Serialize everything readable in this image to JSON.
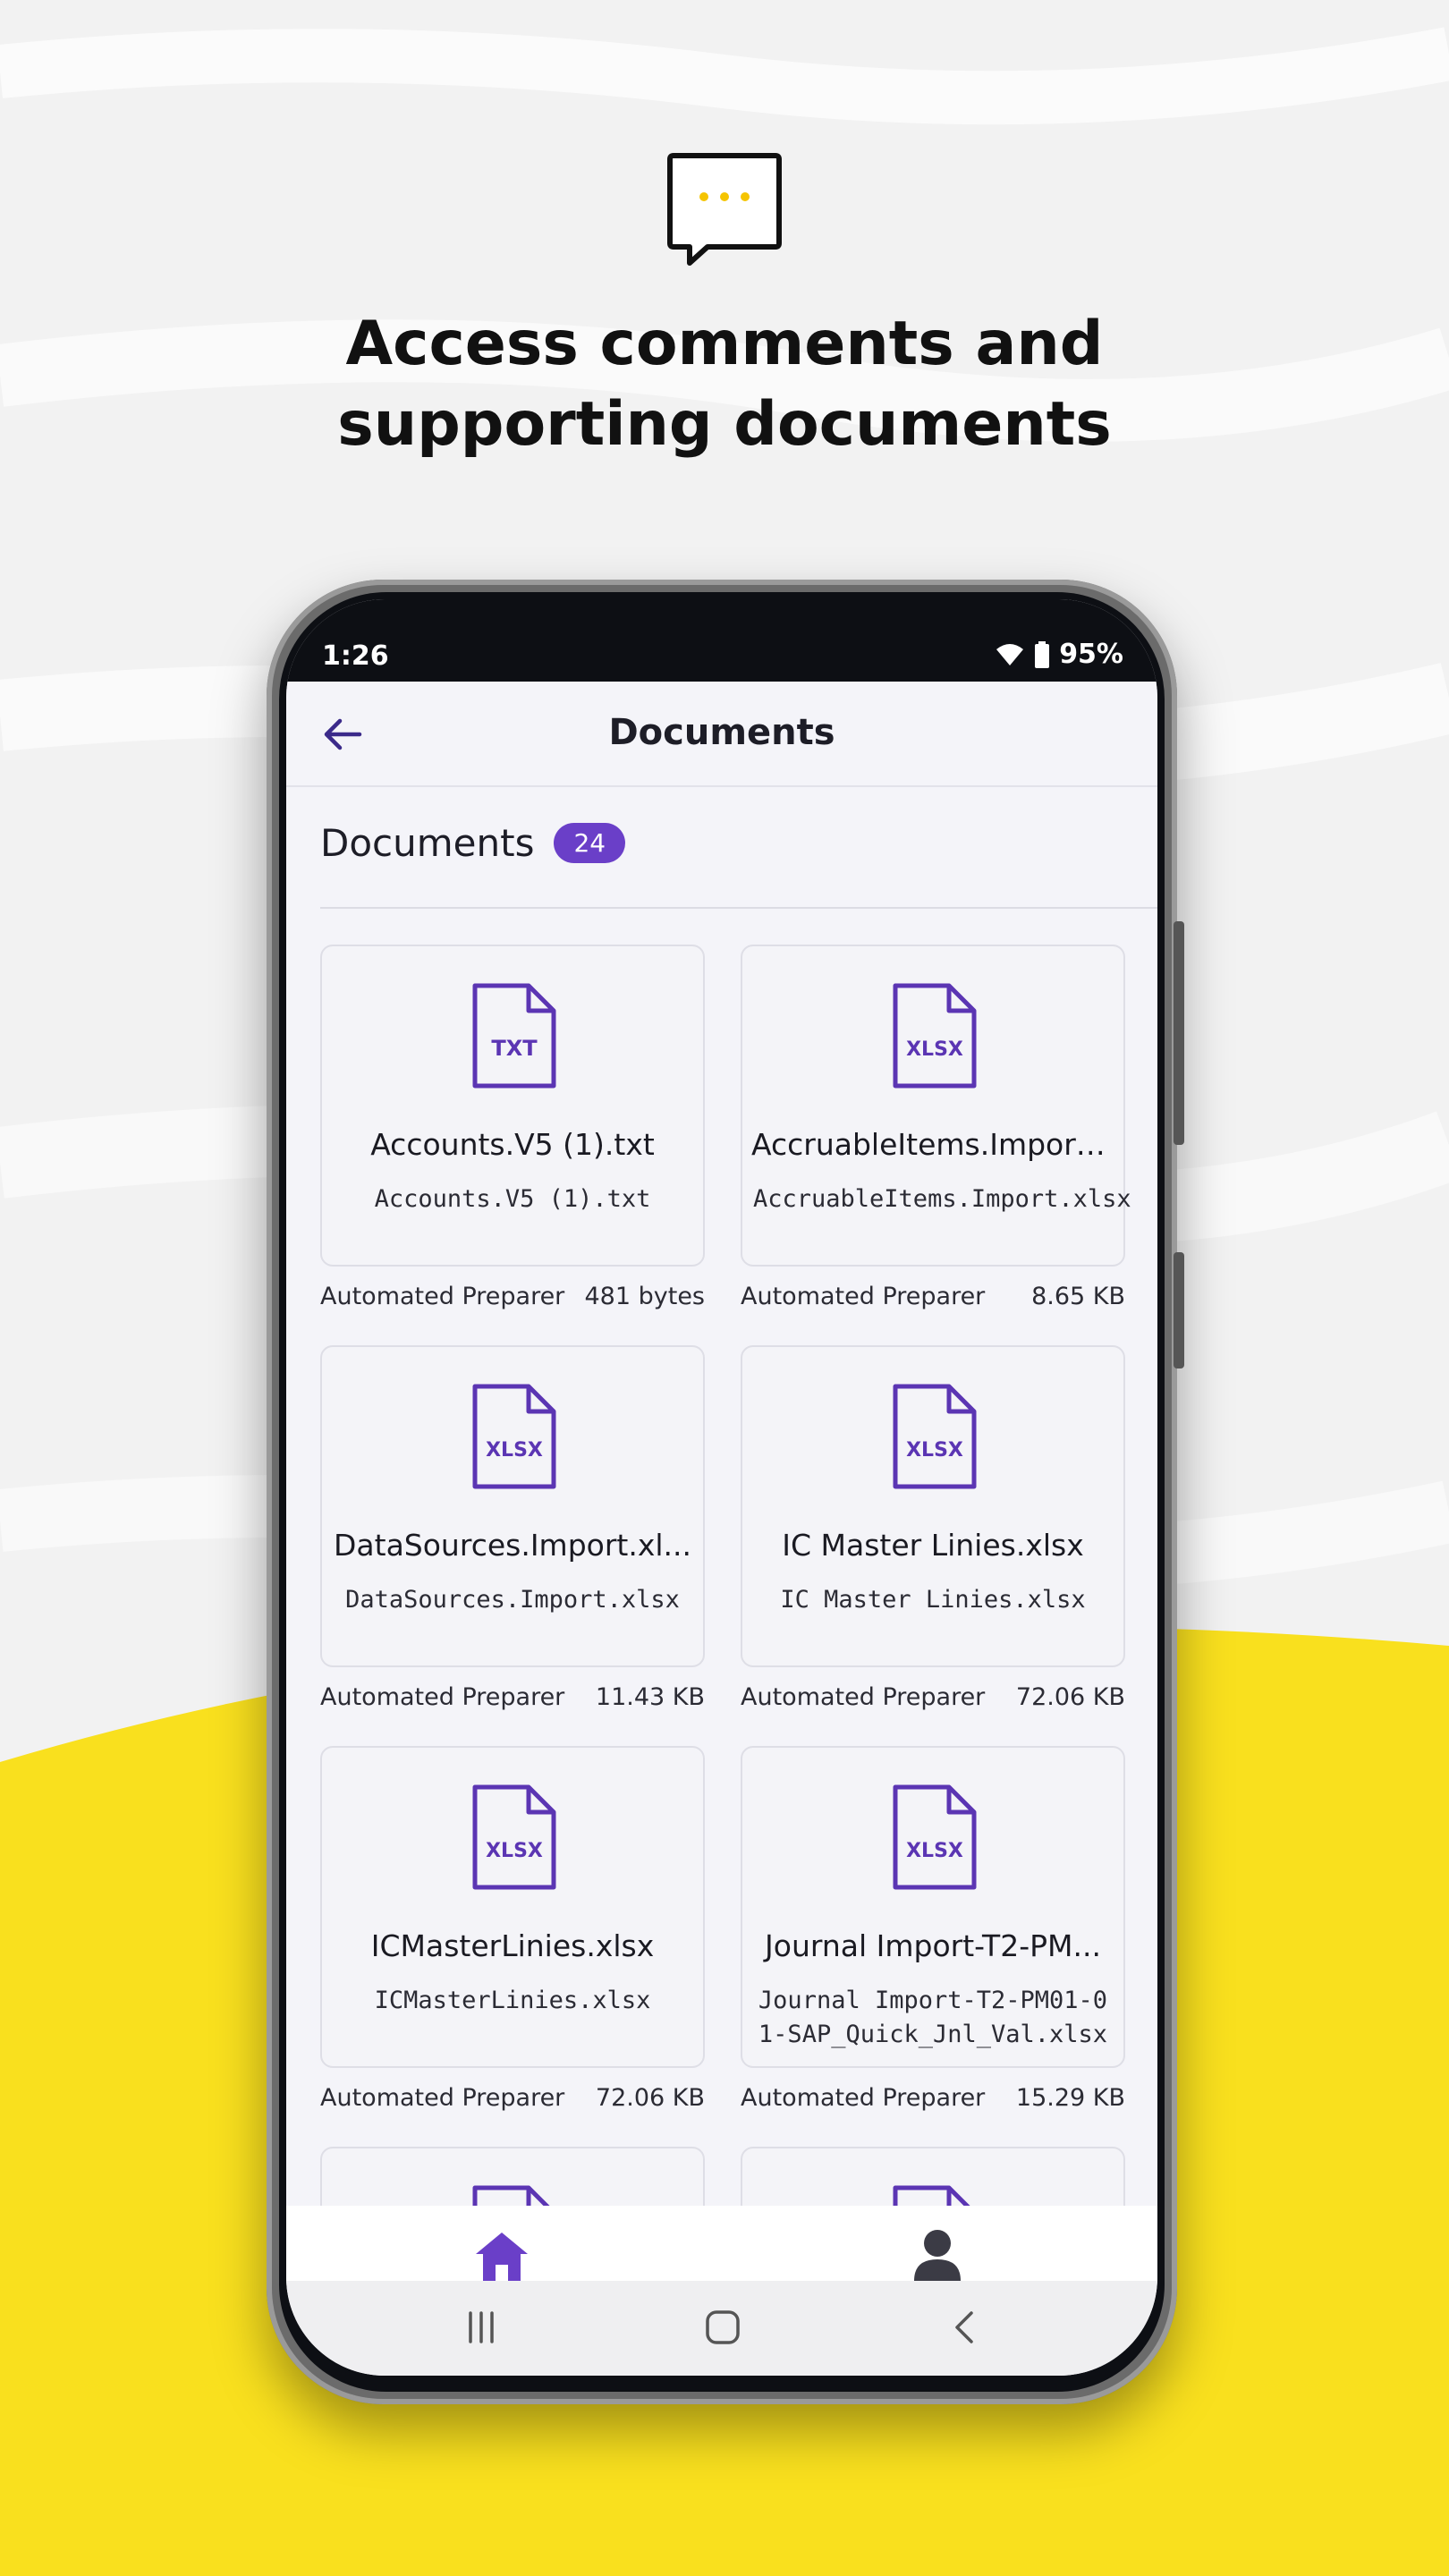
{
  "promo": {
    "headline_line1": "Access comments and",
    "headline_line2": "supporting documents",
    "icon": "chat-bubble-icon",
    "accent_color": "#f5d000"
  },
  "status_bar": {
    "time": "1:26",
    "battery": "95%",
    "icons": [
      "wifi-icon",
      "battery-icon"
    ]
  },
  "app_bar": {
    "title": "Documents",
    "back_icon": "arrow-left-icon"
  },
  "section": {
    "title": "Documents",
    "count": "24",
    "badge_color": "#6a3fc8"
  },
  "documents": [
    {
      "type": "TXT",
      "name": "Accounts.V5 (1).txt",
      "subtitle": "Accounts.V5 (1).txt",
      "author": "Automated Preparer",
      "size": "481 bytes"
    },
    {
      "type": "XLSX",
      "name": "AccruableItems.Import...",
      "subtitle": "AccruableItems.Import.xlsx",
      "author": "Automated Preparer",
      "size": "8.65 KB"
    },
    {
      "type": "XLSX",
      "name": "DataSources.Import.xl...",
      "subtitle": "DataSources.Import.xlsx",
      "author": "Automated Preparer",
      "size": "11.43 KB"
    },
    {
      "type": "XLSX",
      "name": "IC Master Linies.xlsx",
      "subtitle": "IC Master Linies.xlsx",
      "author": "Automated Preparer",
      "size": "72.06 KB"
    },
    {
      "type": "XLSX",
      "name": "ICMasterLinies.xlsx",
      "subtitle": "ICMasterLinies.xlsx",
      "author": "Automated Preparer",
      "size": "72.06 KB"
    },
    {
      "type": "XLSX",
      "name": "Journal Import-T2-PM...",
      "subtitle": "Journal Import-T2-PM01-01-SAP_Quick_Jnl_Val.xlsx",
      "author": "Automated Preparer",
      "size": "15.29 KB"
    }
  ],
  "bottom_nav": {
    "items": [
      "home-icon",
      "profile-icon"
    ],
    "active_color": "#6a3fc8"
  },
  "system_nav": [
    "recent-apps-icon",
    "home-button-icon",
    "back-chevron-icon"
  ]
}
